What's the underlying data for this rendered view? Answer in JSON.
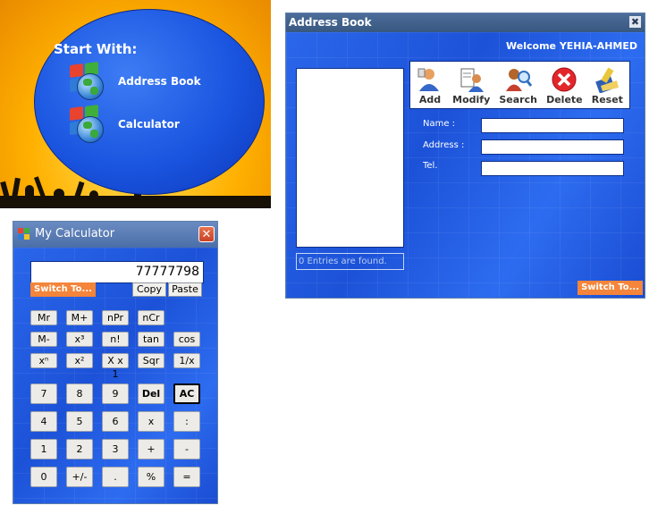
{
  "launcher": {
    "heading": "Start With:",
    "items": [
      {
        "label": "Address Book",
        "icon": "windows-logo-icon"
      },
      {
        "label": "Calculator",
        "icon": "windows-logo-icon"
      }
    ]
  },
  "address_book": {
    "title": "Address Book",
    "close_glyph": "✖",
    "welcome": "Welcome YEHIA-AHMED",
    "toolbar": [
      {
        "label": "Add",
        "icon": "add-user-icon"
      },
      {
        "label": "Modify",
        "icon": "modify-user-icon"
      },
      {
        "label": "Search",
        "icon": "search-user-icon"
      },
      {
        "label": "Delete",
        "icon": "delete-icon"
      },
      {
        "label": "Reset",
        "icon": "reset-icon"
      }
    ],
    "fields": {
      "name_label": "Name :",
      "address_label": "Address :",
      "tel_label": "Tel.",
      "name_value": "",
      "address_value": "",
      "tel_value": ""
    },
    "entries_status": "0 Entries are found.",
    "switch_label": "Switch To..."
  },
  "calculator": {
    "title": "My Calculator",
    "close_glyph": "✕",
    "display": "77777798",
    "switch_label": "Switch To...",
    "copy_label": "Copy",
    "paste_label": "Paste",
    "function_rows": [
      [
        "Mr",
        "M+",
        "nPr",
        "nCr"
      ],
      [
        "M-",
        "x³",
        "n!",
        "tan",
        "cos"
      ],
      [
        "xⁿ",
        "x²",
        "X x 1",
        "Sqr",
        "1/x"
      ]
    ],
    "keypad_rows": [
      [
        "7",
        "8",
        "9",
        "Del",
        "AC"
      ],
      [
        "4",
        "5",
        "6",
        "x",
        ":"
      ],
      [
        "1",
        "2",
        "3",
        "+",
        "-"
      ],
      [
        "0",
        "+/-",
        ".",
        "%",
        "="
      ]
    ],
    "colors": {
      "accent_orange": "#f4853a",
      "window_blue": "#1a4fd6"
    }
  }
}
